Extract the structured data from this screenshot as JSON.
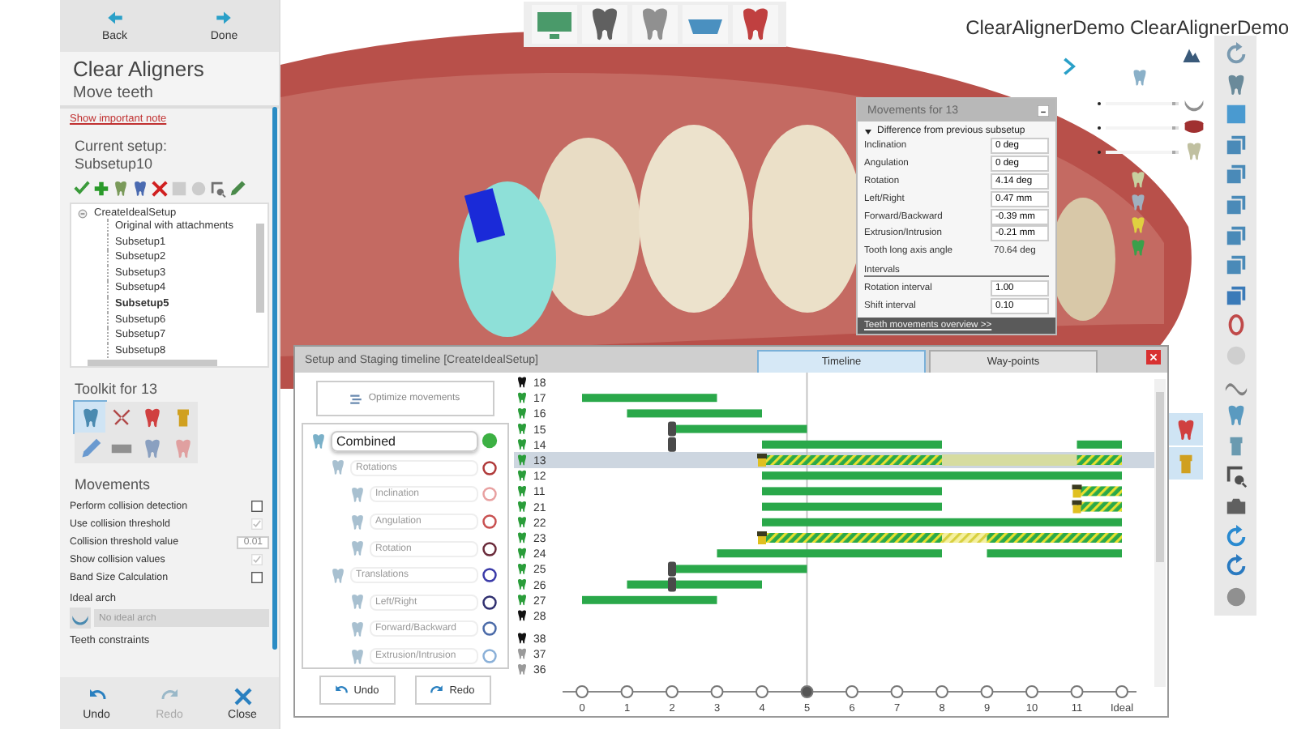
{
  "app_title": "ClearAlignerDemo ClearAlignerDemo",
  "nav": [
    {
      "label": "Back",
      "kind": "back"
    },
    {
      "label": "Done",
      "kind": "done"
    }
  ],
  "title": "Clear Aligners",
  "subtitle": "Move teeth",
  "note_link": "Show important note",
  "current_setup": {
    "label": "Current setup:",
    "value": "Subsetup10"
  },
  "setup_tools": [
    {
      "disabled": false
    },
    {
      "disabled": false
    },
    {
      "disabled": false
    },
    {
      "disabled": false
    },
    {
      "disabled": false
    },
    {
      "disabled": true
    },
    {
      "disabled": true
    },
    {
      "disabled": false
    },
    {
      "disabled": false
    }
  ],
  "tree": {
    "label": "CreateIdealSetup",
    "expanded": true,
    "children": [
      {
        "label": "Original with attachments",
        "selected": false
      },
      {
        "label": "Subsetup1",
        "selected": false
      },
      {
        "label": "Subsetup2",
        "selected": false
      },
      {
        "label": "Subsetup3",
        "selected": false
      },
      {
        "label": "Subsetup4",
        "selected": false
      },
      {
        "label": "Subsetup5",
        "selected": true
      },
      {
        "label": "Subsetup6",
        "selected": false
      },
      {
        "label": "Subsetup7",
        "selected": false
      },
      {
        "label": "Subsetup8",
        "selected": false
      }
    ]
  },
  "toolkit": {
    "title": "Toolkit for 13",
    "tools": [
      {
        "selected": true
      },
      {
        "selected": false
      },
      {
        "selected": false
      },
      {
        "selected": false
      },
      {
        "selected": false
      },
      {
        "selected": false
      },
      {
        "selected": false
      },
      {
        "selected": false
      }
    ]
  },
  "movements": {
    "title": "Movements",
    "options": [
      {
        "kind": "checkbox",
        "label": "Perform collision detection",
        "checked": false,
        "disabled": false
      },
      {
        "kind": "checkbox",
        "label": "Use collision threshold",
        "checked": true,
        "disabled": true
      },
      {
        "kind": "spinner",
        "label": "Collision threshold value",
        "value": "0.01"
      },
      {
        "kind": "checkbox",
        "label": "Show collision values",
        "checked": true,
        "disabled": true
      },
      {
        "kind": "checkbox",
        "label": "Band Size Calculation",
        "checked": false,
        "disabled": false
      }
    ]
  },
  "ideal_arch": {
    "label": "Ideal arch",
    "placeholder": "No ideal arch",
    "disabled": true
  },
  "constraints_label": "Teeth constraints",
  "bottom_actions": [
    {
      "label": "Undo",
      "kind": "undo",
      "disabled": false
    },
    {
      "label": "Redo",
      "kind": "redo",
      "disabled": true
    },
    {
      "label": "Close",
      "kind": "close",
      "disabled": false
    }
  ],
  "view_sliders": [
    {
      "level": 0.95
    },
    {
      "level": 0.95
    },
    {
      "level": 0.95
    }
  ],
  "side_tools": [
    {
      "selected": true
    },
    {
      "selected": true
    }
  ],
  "movements_popup": {
    "title": "Movements for 13",
    "section": "Difference from previous subsetup",
    "expanded": true,
    "rows": [
      {
        "kind": "field",
        "label": "Inclination",
        "value": "0 deg"
      },
      {
        "kind": "field",
        "label": "Angulation",
        "value": "0 deg"
      },
      {
        "kind": "field",
        "label": "Rotation",
        "value": "4.14 deg"
      },
      {
        "kind": "field",
        "label": "Left/Right",
        "value": "0.47 mm"
      },
      {
        "kind": "field",
        "label": "Forward/Backward",
        "value": "-0.39 mm"
      },
      {
        "kind": "field",
        "label": "Extrusion/Intrusion",
        "value": "-0.21 mm"
      },
      {
        "kind": "text",
        "label": "Tooth long axis angle",
        "value": "70.64 deg"
      }
    ],
    "intervals_title": "Intervals",
    "intervals": [
      {
        "label": "Rotation interval",
        "value": "1.00"
      },
      {
        "label": "Shift interval",
        "value": "0.10"
      }
    ],
    "footer_link": "Teeth movements overview >>"
  },
  "timeline": {
    "title": "Setup and Staging timeline  [CreateIdealSetup]",
    "tabs": [
      {
        "label": "Timeline",
        "selected": true
      },
      {
        "label": "Way-points",
        "selected": false
      }
    ],
    "optimize_label": "Optimize movements",
    "movement_types": [
      {
        "label": "Combined",
        "color": "#3cb043",
        "selected": true,
        "children": [
          {
            "label": "Rotations",
            "color": "#b03a3a",
            "selected": false,
            "children": [
              {
                "label": "Inclination",
                "color": "#e8a0a0",
                "selected": false
              },
              {
                "label": "Angulation",
                "color": "#c85050",
                "selected": false
              },
              {
                "label": "Rotation",
                "color": "#6a2a3a",
                "selected": false
              }
            ]
          },
          {
            "label": "Translations",
            "color": "#3a3aa8",
            "selected": false,
            "children": [
              {
                "label": "Left/Right",
                "color": "#303070",
                "selected": false
              },
              {
                "label": "Forward/Backward",
                "color": "#4a6aa8",
                "selected": false
              },
              {
                "label": "Extrusion/Intrusion",
                "color": "#8ab0d8",
                "selected": false
              }
            ]
          }
        ]
      }
    ],
    "actions": [
      {
        "label": "Undo",
        "kind": "undo"
      },
      {
        "label": "Redo",
        "kind": "redo"
      }
    ],
    "stages": [
      {
        "label": "0",
        "selected": false
      },
      {
        "label": "1",
        "selected": false
      },
      {
        "label": "2",
        "selected": false
      },
      {
        "label": "3",
        "selected": false
      },
      {
        "label": "4",
        "selected": false
      },
      {
        "label": "5",
        "selected": true
      },
      {
        "label": "6",
        "selected": false
      },
      {
        "label": "7",
        "selected": false
      },
      {
        "label": "8",
        "selected": false
      },
      {
        "label": "9",
        "selected": false
      },
      {
        "label": "10",
        "selected": false
      },
      {
        "label": "11",
        "selected": false
      },
      {
        "label": "Ideal",
        "selected": false
      }
    ],
    "rows": [
      {
        "tooth": "18",
        "color": "#111111",
        "selected": false
      },
      {
        "tooth": "17",
        "color": "#2a9d3a",
        "selected": false,
        "spans": [
          {
            "kind": "solid"
          },
          {
            "kind": "solid"
          },
          {
            "kind": "solid"
          },
          {
            "kind": "none"
          },
          {
            "kind": "none"
          },
          {
            "kind": "none"
          },
          {
            "kind": "none"
          },
          {
            "kind": "none"
          },
          {
            "kind": "none"
          },
          {
            "kind": "none"
          },
          {
            "kind": "none"
          },
          {
            "kind": "none"
          }
        ]
      },
      {
        "tooth": "16",
        "color": "#2a9d3a",
        "selected": false,
        "spans": [
          {
            "kind": "none"
          },
          {
            "kind": "solid"
          },
          {
            "kind": "solid"
          },
          {
            "kind": "solid"
          },
          {
            "kind": "none"
          },
          {
            "kind": "none"
          },
          {
            "kind": "none"
          },
          {
            "kind": "none"
          },
          {
            "kind": "none"
          },
          {
            "kind": "none"
          },
          {
            "kind": "none"
          },
          {
            "kind": "none"
          }
        ]
      },
      {
        "tooth": "15",
        "color": "#2a9d3a",
        "selected": false,
        "spans": [
          {
            "kind": "none"
          },
          {
            "kind": "none"
          },
          {
            "kind": "solid",
            "handle": true
          },
          {
            "kind": "solid"
          },
          {
            "kind": "solid"
          },
          {
            "kind": "none"
          },
          {
            "kind": "none"
          },
          {
            "kind": "none"
          },
          {
            "kind": "none"
          },
          {
            "kind": "none"
          },
          {
            "kind": "none"
          },
          {
            "kind": "none"
          }
        ]
      },
      {
        "tooth": "14",
        "color": "#2a9d3a",
        "selected": false,
        "spans": [
          {
            "kind": "none"
          },
          {
            "kind": "none"
          },
          {
            "kind": "none",
            "handle": true
          },
          {
            "kind": "none"
          },
          {
            "kind": "solid"
          },
          {
            "kind": "solid"
          },
          {
            "kind": "solid"
          },
          {
            "kind": "solid"
          },
          {
            "kind": "none"
          },
          {
            "kind": "none"
          },
          {
            "kind": "none"
          },
          {
            "kind": "solid"
          }
        ]
      },
      {
        "tooth": "13",
        "color": "#2a9d3a",
        "selected": true,
        "spans": [
          {
            "kind": "none"
          },
          {
            "kind": "none"
          },
          {
            "kind": "none"
          },
          {
            "kind": "none"
          },
          {
            "kind": "hatched",
            "attachment": true
          },
          {
            "kind": "hatched"
          },
          {
            "kind": "hatched"
          },
          {
            "kind": "hatched"
          },
          {
            "kind": "pale"
          },
          {
            "kind": "pale"
          },
          {
            "kind": "pale"
          },
          {
            "kind": "hatched"
          }
        ]
      },
      {
        "tooth": "12",
        "color": "#2a9d3a",
        "selected": false,
        "spans": [
          {
            "kind": "none"
          },
          {
            "kind": "none"
          },
          {
            "kind": "none"
          },
          {
            "kind": "none"
          },
          {
            "kind": "solid"
          },
          {
            "kind": "solid"
          },
          {
            "kind": "solid"
          },
          {
            "kind": "solid"
          },
          {
            "kind": "solid"
          },
          {
            "kind": "solid"
          },
          {
            "kind": "solid"
          },
          {
            "kind": "solid"
          }
        ]
      },
      {
        "tooth": "11",
        "color": "#2a9d3a",
        "selected": false,
        "spans": [
          {
            "kind": "none"
          },
          {
            "kind": "none"
          },
          {
            "kind": "none"
          },
          {
            "kind": "none"
          },
          {
            "kind": "solid"
          },
          {
            "kind": "solid"
          },
          {
            "kind": "solid"
          },
          {
            "kind": "solid"
          },
          {
            "kind": "none"
          },
          {
            "kind": "none"
          },
          {
            "kind": "none"
          },
          {
            "kind": "hatched",
            "attachment": true
          }
        ]
      },
      {
        "tooth": "21",
        "color": "#2a9d3a",
        "selected": false,
        "spans": [
          {
            "kind": "none"
          },
          {
            "kind": "none"
          },
          {
            "kind": "none"
          },
          {
            "kind": "none"
          },
          {
            "kind": "solid"
          },
          {
            "kind": "solid"
          },
          {
            "kind": "solid"
          },
          {
            "kind": "solid"
          },
          {
            "kind": "none"
          },
          {
            "kind": "none"
          },
          {
            "kind": "none"
          },
          {
            "kind": "hatched",
            "attachment": true
          }
        ]
      },
      {
        "tooth": "22",
        "color": "#2a9d3a",
        "selected": false,
        "spans": [
          {
            "kind": "none"
          },
          {
            "kind": "none"
          },
          {
            "kind": "none"
          },
          {
            "kind": "none"
          },
          {
            "kind": "solid"
          },
          {
            "kind": "solid"
          },
          {
            "kind": "solid"
          },
          {
            "kind": "solid"
          },
          {
            "kind": "solid"
          },
          {
            "kind": "solid"
          },
          {
            "kind": "solid"
          },
          {
            "kind": "solid"
          }
        ]
      },
      {
        "tooth": "23",
        "color": "#2a9d3a",
        "selected": false,
        "spans": [
          {
            "kind": "none"
          },
          {
            "kind": "none"
          },
          {
            "kind": "none"
          },
          {
            "kind": "none"
          },
          {
            "kind": "hatched",
            "attachment": true
          },
          {
            "kind": "hatched"
          },
          {
            "kind": "hatched"
          },
          {
            "kind": "hatched"
          },
          {
            "kind": "light"
          },
          {
            "kind": "hatched"
          },
          {
            "kind": "hatched"
          },
          {
            "kind": "hatched"
          }
        ]
      },
      {
        "tooth": "24",
        "color": "#2a9d3a",
        "selected": false,
        "spans": [
          {
            "kind": "none"
          },
          {
            "kind": "none"
          },
          {
            "kind": "none"
          },
          {
            "kind": "solid"
          },
          {
            "kind": "solid"
          },
          {
            "kind": "solid"
          },
          {
            "kind": "solid"
          },
          {
            "kind": "solid"
          },
          {
            "kind": "none"
          },
          {
            "kind": "solid"
          },
          {
            "kind": "solid"
          },
          {
            "kind": "solid"
          }
        ]
      },
      {
        "tooth": "25",
        "color": "#2a9d3a",
        "selected": false,
        "spans": [
          {
            "kind": "none"
          },
          {
            "kind": "none"
          },
          {
            "kind": "solid",
            "handle": true
          },
          {
            "kind": "solid"
          },
          {
            "kind": "solid"
          },
          {
            "kind": "none"
          },
          {
            "kind": "none"
          },
          {
            "kind": "none"
          },
          {
            "kind": "none"
          },
          {
            "kind": "none"
          },
          {
            "kind": "none"
          },
          {
            "kind": "none"
          }
        ]
      },
      {
        "tooth": "26",
        "color": "#2a9d3a",
        "selected": false,
        "spans": [
          {
            "kind": "none"
          },
          {
            "kind": "solid"
          },
          {
            "kind": "solid",
            "handle": true
          },
          {
            "kind": "solid"
          },
          {
            "kind": "none"
          },
          {
            "kind": "none"
          },
          {
            "kind": "none"
          },
          {
            "kind": "none"
          },
          {
            "kind": "none"
          },
          {
            "kind": "none"
          },
          {
            "kind": "none"
          },
          {
            "kind": "none"
          }
        ]
      },
      {
        "tooth": "27",
        "color": "#2a9d3a",
        "selected": false,
        "spans": [
          {
            "kind": "solid"
          },
          {
            "kind": "solid"
          },
          {
            "kind": "solid"
          },
          {
            "kind": "none"
          },
          {
            "kind": "none"
          },
          {
            "kind": "none"
          },
          {
            "kind": "none"
          },
          {
            "kind": "none"
          },
          {
            "kind": "none"
          },
          {
            "kind": "none"
          },
          {
            "kind": "none"
          },
          {
            "kind": "none"
          }
        ]
      },
      {
        "tooth": "28",
        "color": "#111111",
        "selected": false
      }
    ],
    "rows_2": [
      {
        "tooth": "38",
        "color": "#111111",
        "selected": false
      },
      {
        "tooth": "37",
        "color": "#9a9a9a",
        "selected": false
      },
      {
        "tooth": "36",
        "color": "#9a9a9a",
        "selected": false
      }
    ]
  }
}
